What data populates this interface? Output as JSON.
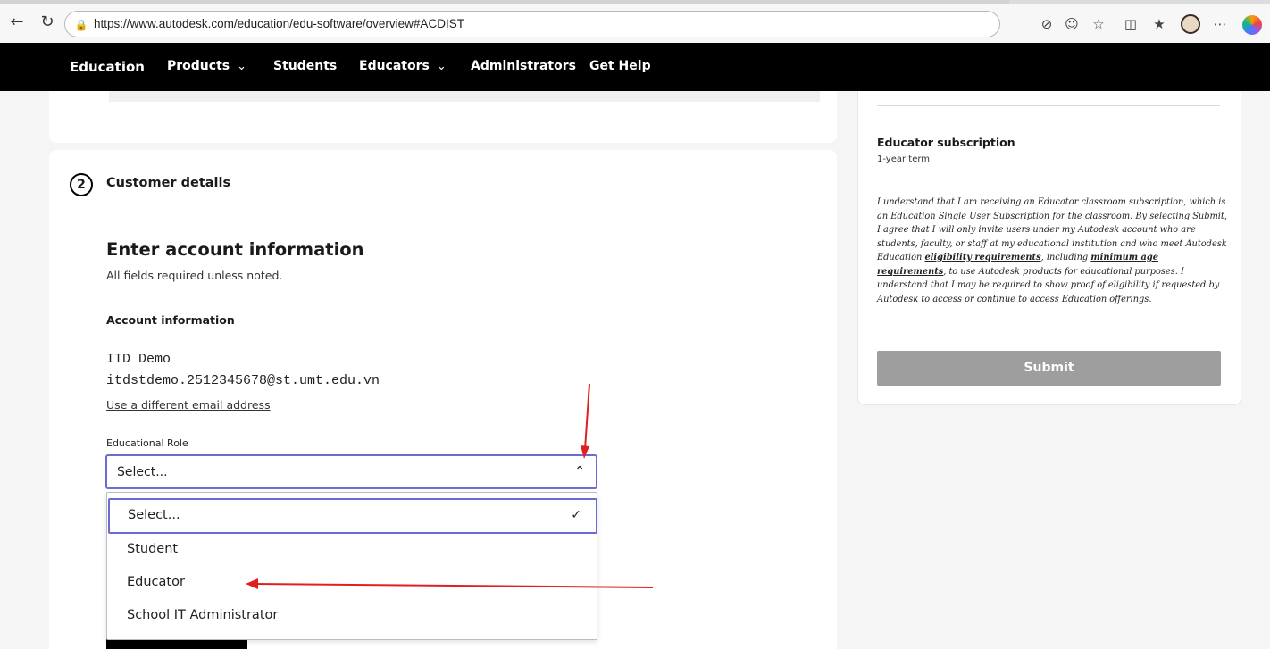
{
  "browser": {
    "url": "https://www.autodesk.com/education/edu-software/overview#ACDIST",
    "icons": [
      "back-icon",
      "refresh-icon",
      "lock-icon",
      "tracking-icon",
      "emoji-icon",
      "favorite-icon",
      "split-icon",
      "favorites-list-icon",
      "profile-icon",
      "more-icon",
      "copilot-icon"
    ]
  },
  "nav": {
    "brand": "Education",
    "items": [
      {
        "label": "Products",
        "dropdown": true
      },
      {
        "label": "Students",
        "dropdown": false
      },
      {
        "label": "Educators",
        "dropdown": true
      },
      {
        "label": "Administrators",
        "dropdown": false
      },
      {
        "label": "Get Help",
        "dropdown": false
      }
    ]
  },
  "step": {
    "number": "2",
    "title": "Customer details"
  },
  "form": {
    "heading": "Enter account information",
    "hint": "All fields required unless noted.",
    "section": "Account information",
    "name": "ITD Demo",
    "email": "itdstdemo.2512345678@st.umt.edu.vn",
    "change_email_link": "Use a different email address",
    "role_label": "Educational Role",
    "role_value": "Select...",
    "role_options": [
      "Select...",
      "Student",
      "Educator",
      "School IT Administrator"
    ]
  },
  "sidebar": {
    "plan_title": "Educator subscription",
    "plan_term": "1-year term",
    "terms_part1": "I understand that I am receiving an Educator classroom subscription, which is an Education Single User Subscription for the classroom. By selecting Submit, I agree that I will only invite users under my Autodesk account who are students, faculty, or staff at my educational institution and who meet Autodesk Education ",
    "terms_link1": "eligibility requirements",
    "terms_part2": ", including ",
    "terms_link2": "minimum age requirements",
    "terms_part3": ", to use Autodesk products for educational purposes. I understand that I may be required to show proof of eligibility if requested by Autodesk to access or continue to access Education offerings.",
    "submit_label": "Submit"
  },
  "colors": {
    "nav_bg": "#000000",
    "focus_border": "#6b6bd6",
    "submit_disabled": "#9e9e9e",
    "annotation_arrow": "#e02020"
  }
}
